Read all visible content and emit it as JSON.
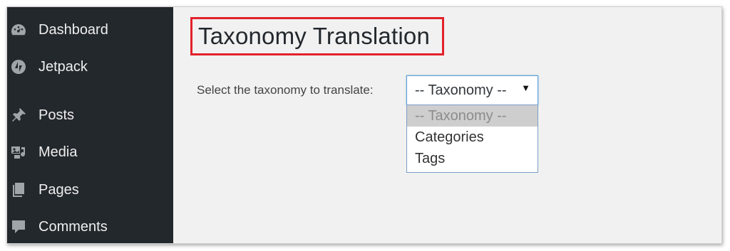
{
  "sidebar": {
    "items": [
      {
        "label": "Dashboard",
        "icon": "dashboard-icon"
      },
      {
        "label": "Jetpack",
        "icon": "jetpack-icon"
      },
      {
        "label": "Posts",
        "icon": "pushpin-icon"
      },
      {
        "label": "Media",
        "icon": "media-icon"
      },
      {
        "label": "Pages",
        "icon": "pages-icon"
      },
      {
        "label": "Comments",
        "icon": "comment-bubble-icon"
      }
    ],
    "background": "#23282d"
  },
  "main": {
    "title": "Taxonomy Translation",
    "highlight_color": "#e2222a",
    "select_label": "Select the taxonomy to translate:",
    "select": {
      "current_value": "-- Taxonomy --",
      "options": [
        "-- Taxonomy --",
        "Categories",
        "Tags"
      ],
      "highlighted_option": "-- Taxonomy --"
    }
  }
}
